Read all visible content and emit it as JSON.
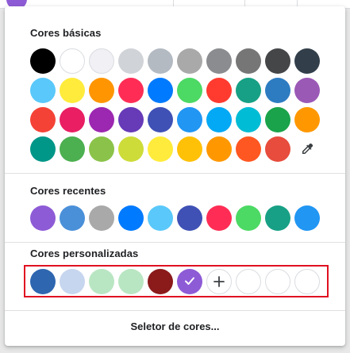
{
  "sections": {
    "basic_title": "Cores básicas",
    "recent_title": "Cores recentes",
    "custom_title": "Cores personalizadas"
  },
  "basic_rows": [
    [
      {
        "color": "#000000",
        "name": "black"
      },
      {
        "color": "#ffffff",
        "name": "white"
      },
      {
        "color": "#f0f0f5",
        "name": "off-white"
      },
      {
        "color": "#d0d3d7",
        "name": "light-gray"
      },
      {
        "color": "#b4bac2",
        "name": "silver-gray"
      },
      {
        "color": "#a9a9a9",
        "name": "gray"
      },
      {
        "color": "#8a8c8f",
        "name": "medium-gray"
      },
      {
        "color": "#767676",
        "name": "dim-gray"
      },
      {
        "color": "#444648",
        "name": "dark-gray"
      },
      {
        "color": "#323f4a",
        "name": "charcoal"
      }
    ],
    [
      {
        "color": "#5ac8fa",
        "name": "sky-blue"
      },
      {
        "color": "#ffeb3b",
        "name": "yellow"
      },
      {
        "color": "#ff9500",
        "name": "orange"
      },
      {
        "color": "#ff2d55",
        "name": "pink-red"
      },
      {
        "color": "#007aff",
        "name": "blue"
      },
      {
        "color": "#4cd964",
        "name": "green"
      },
      {
        "color": "#ff3b30",
        "name": "red"
      },
      {
        "color": "#17a085",
        "name": "teal"
      },
      {
        "color": "#2d7cc1",
        "name": "steel-blue"
      },
      {
        "color": "#9b59b6",
        "name": "purple"
      }
    ],
    [
      {
        "color": "#f44336",
        "name": "red"
      },
      {
        "color": "#e91e63",
        "name": "pink"
      },
      {
        "color": "#9c27b0",
        "name": "purple"
      },
      {
        "color": "#673ab7",
        "name": "deep-purple"
      },
      {
        "color": "#3f51b5",
        "name": "indigo"
      },
      {
        "color": "#2196f3",
        "name": "blue"
      },
      {
        "color": "#03a9f4",
        "name": "light-blue"
      },
      {
        "color": "#00bcd4",
        "name": "cyan"
      },
      {
        "color": "#1aa34a",
        "name": "green"
      },
      {
        "color": "#ff9800",
        "name": "orange"
      }
    ],
    [
      {
        "color": "#009688",
        "name": "teal"
      },
      {
        "color": "#4caf50",
        "name": "green"
      },
      {
        "color": "#8bc34a",
        "name": "light-green"
      },
      {
        "color": "#cddc39",
        "name": "lime"
      },
      {
        "color": "#ffeb3b",
        "name": "yellow"
      },
      {
        "color": "#ffc107",
        "name": "amber"
      },
      {
        "color": "#ff9800",
        "name": "orange"
      },
      {
        "color": "#ff5722",
        "name": "deep-orange"
      },
      {
        "color": "#e74c3c",
        "name": "alizarin"
      }
    ]
  ],
  "recent": [
    {
      "color": "#8e5bd6",
      "name": "purple"
    },
    {
      "color": "#4a90d9",
      "name": "blue"
    },
    {
      "color": "#a9a9a9",
      "name": "gray"
    },
    {
      "color": "#007aff",
      "name": "blue"
    },
    {
      "color": "#5ac8fa",
      "name": "sky-blue"
    },
    {
      "color": "#3f51b5",
      "name": "indigo"
    },
    {
      "color": "#ff2d55",
      "name": "pink-red"
    },
    {
      "color": "#4cd964",
      "name": "green"
    },
    {
      "color": "#17a085",
      "name": "teal"
    },
    {
      "color": "#2196f3",
      "name": "blue"
    }
  ],
  "custom": [
    {
      "color": "#2e66b0",
      "name": "blue",
      "selected": false,
      "empty": false
    },
    {
      "color": "#c7d6ef",
      "name": "light-blue",
      "selected": false,
      "empty": false
    },
    {
      "color": "#b9e6c2",
      "name": "mint",
      "selected": false,
      "empty": false
    },
    {
      "color": "#b9e6c2",
      "name": "mint",
      "selected": false,
      "empty": false
    },
    {
      "color": "#8b1a1a",
      "name": "dark-red",
      "selected": false,
      "empty": false
    },
    {
      "color": "#8e5bd6",
      "name": "purple",
      "selected": true,
      "empty": false
    }
  ],
  "custom_empty_slots": 3,
  "icons": {
    "eyedropper": "eyedropper-icon",
    "add": "plus-icon",
    "check": "check-icon"
  },
  "picker_label": "Seletor de cores...",
  "accent_highlight": "#e01020"
}
